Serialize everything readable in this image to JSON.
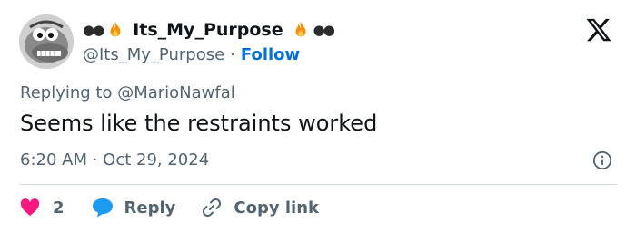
{
  "author": {
    "display_name": "Its_My_Purpose",
    "handle": "@Its_My_Purpose",
    "separator": "·",
    "follow_label": "Follow",
    "name_decoration_left": "👀🔥",
    "name_decoration_right": "🔥👀"
  },
  "reply": {
    "prefix": "Replying to ",
    "target": "@MarioNawfal"
  },
  "tweet": {
    "text": "Seems like the restraints worked",
    "timestamp": "6:20 AM · Oct 29, 2024"
  },
  "actions": {
    "like_count": "2",
    "reply_label": "Reply",
    "copy_label": "Copy link"
  },
  "colors": {
    "text": "#0f1419",
    "secondary": "#536471",
    "link": "#006fd6",
    "like": "#f91880",
    "reply": "#1d9bf0",
    "divider": "#cfd9de"
  },
  "icons": {
    "platform_logo": "x-logo-icon",
    "info": "info-icon",
    "like": "heart-icon",
    "reply": "chat-bubble-icon",
    "copy": "link-icon",
    "fire": "fire-icon",
    "eyes": "eyes-icon"
  }
}
